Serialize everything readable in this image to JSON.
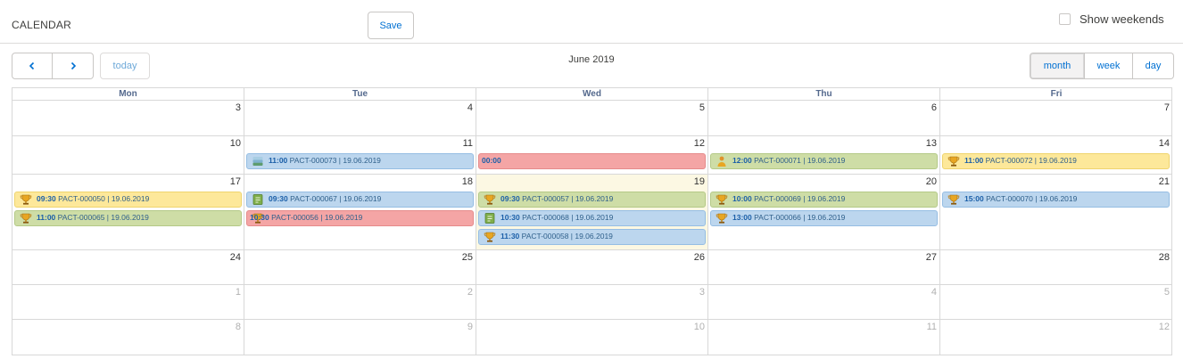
{
  "header": {
    "title": "CALENDAR",
    "save_label": "Save",
    "show_weekends_label": "Show weekends"
  },
  "toolbar": {
    "prev_icon": "chevron-left-icon",
    "next_icon": "chevron-right-icon",
    "today_label": "today",
    "month_title": "June 2019",
    "views": [
      {
        "label": "month",
        "active": true
      },
      {
        "label": "week",
        "active": false
      },
      {
        "label": "day",
        "active": false
      }
    ]
  },
  "colors": {
    "accent": "#0070d2",
    "event_blue": "#bcd6ee",
    "event_green": "#cedda6",
    "event_yellow": "#fde89a",
    "event_red": "#f4a5a5",
    "today_bg": "#fcf8e3"
  },
  "weekdays": [
    "Mon",
    "Tue",
    "Wed",
    "Thu",
    "Fri"
  ],
  "weeks": [
    {
      "days": [
        {
          "num": "3",
          "current": true,
          "events": []
        },
        {
          "num": "4",
          "current": true,
          "events": []
        },
        {
          "num": "5",
          "current": true,
          "events": []
        },
        {
          "num": "6",
          "current": true,
          "events": []
        },
        {
          "num": "7",
          "current": true,
          "events": []
        }
      ]
    },
    {
      "days": [
        {
          "num": "10",
          "current": true,
          "events": []
        },
        {
          "num": "11",
          "current": true,
          "events": [
            {
              "time": "11:00",
              "label": "PACT-000073 | 19.06.2019",
              "color": "blue",
              "icon": "stack-icon"
            }
          ]
        },
        {
          "num": "12",
          "current": true,
          "events": [
            {
              "time": "00:00",
              "label": "",
              "color": "red",
              "icon": ""
            }
          ]
        },
        {
          "num": "13",
          "current": true,
          "events": [
            {
              "time": "12:00",
              "label": "PACT-000071 | 19.06.2019",
              "color": "green",
              "icon": "person-icon"
            }
          ]
        },
        {
          "num": "14",
          "current": true,
          "events": [
            {
              "time": "11:00",
              "label": "PACT-000072 | 19.06.2019",
              "color": "yellow",
              "icon": "trophy-icon"
            }
          ]
        }
      ]
    },
    {
      "days": [
        {
          "num": "17",
          "current": true,
          "events": [
            {
              "time": "09:30",
              "label": "PACT-000050 | 19.06.2019",
              "color": "yellow",
              "icon": "trophy-icon"
            },
            {
              "time": "11:00",
              "label": "PACT-000065 | 19.06.2019",
              "color": "green",
              "icon": "trophy-icon"
            }
          ]
        },
        {
          "num": "18",
          "current": true,
          "events": [
            {
              "time": "09:30",
              "label": "PACT-000067 | 19.06.2019",
              "color": "blue",
              "icon": "document-icon"
            },
            {
              "time": "10:30",
              "label": "PACT-000056 | 19.06.2019",
              "color": "red",
              "icon": "trophy-icon"
            }
          ]
        },
        {
          "num": "19",
          "current": true,
          "today": true,
          "events": [
            {
              "time": "09:30",
              "label": "PACT-000057 | 19.06.2019",
              "color": "green",
              "icon": "trophy-icon"
            },
            {
              "time": "10:30",
              "label": "PACT-000068 | 19.06.2019",
              "color": "blue",
              "icon": "document-icon"
            },
            {
              "time": "11:30",
              "label": "PACT-000058 | 19.06.2019",
              "color": "blue",
              "icon": "trophy-icon"
            }
          ]
        },
        {
          "num": "20",
          "current": true,
          "events": [
            {
              "time": "10:00",
              "label": "PACT-000069 | 19.06.2019",
              "color": "green",
              "icon": "trophy-icon"
            },
            {
              "time": "13:00",
              "label": "PACT-000066 | 19.06.2019",
              "color": "blue",
              "icon": "trophy-icon"
            }
          ]
        },
        {
          "num": "21",
          "current": true,
          "events": [
            {
              "time": "15:00",
              "label": "PACT-000070 | 19.06.2019",
              "color": "blue",
              "icon": "trophy-icon"
            }
          ]
        }
      ]
    },
    {
      "days": [
        {
          "num": "24",
          "current": true,
          "events": []
        },
        {
          "num": "25",
          "current": true,
          "events": []
        },
        {
          "num": "26",
          "current": true,
          "events": []
        },
        {
          "num": "27",
          "current": true,
          "events": []
        },
        {
          "num": "28",
          "current": true,
          "events": []
        }
      ]
    },
    {
      "days": [
        {
          "num": "1",
          "current": false,
          "events": []
        },
        {
          "num": "2",
          "current": false,
          "events": []
        },
        {
          "num": "3",
          "current": false,
          "events": []
        },
        {
          "num": "4",
          "current": false,
          "events": []
        },
        {
          "num": "5",
          "current": false,
          "events": []
        }
      ]
    },
    {
      "days": [
        {
          "num": "8",
          "current": false,
          "events": []
        },
        {
          "num": "9",
          "current": false,
          "events": []
        },
        {
          "num": "10",
          "current": false,
          "events": []
        },
        {
          "num": "11",
          "current": false,
          "events": []
        },
        {
          "num": "12",
          "current": false,
          "events": []
        }
      ]
    }
  ]
}
